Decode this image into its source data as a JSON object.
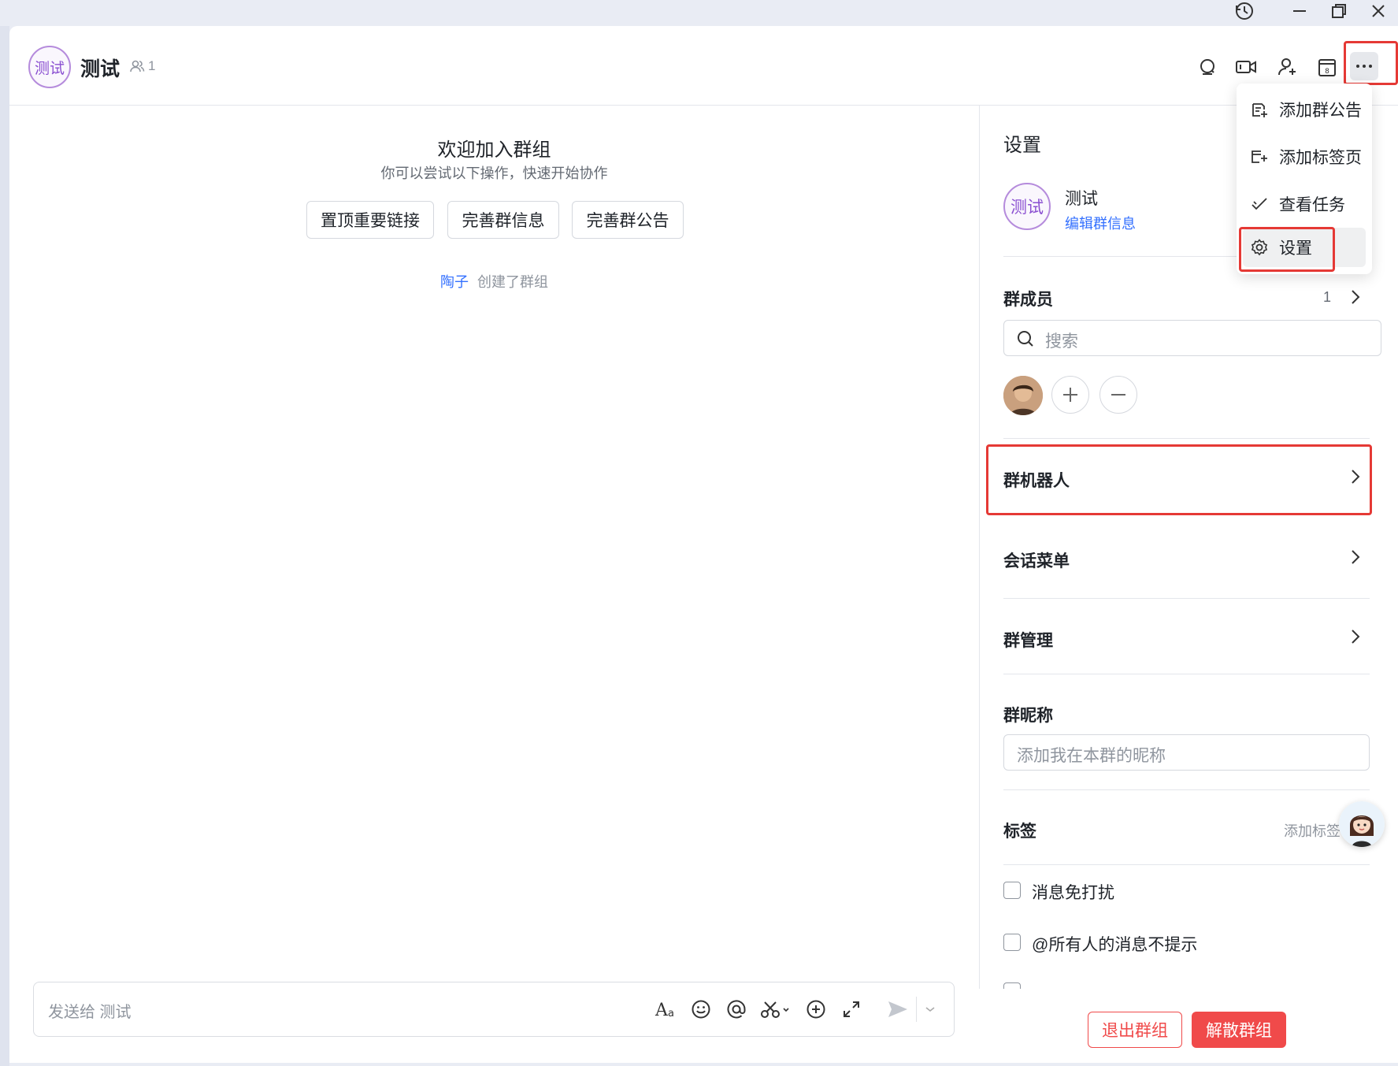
{
  "header": {
    "group_avatar_text": "测试",
    "group_name": "测试",
    "member_count": "1"
  },
  "chat": {
    "welcome_title": "欢迎加入群组",
    "welcome_subtitle": "你可以尝试以下操作，快速开始协作",
    "quick_actions": [
      "置顶重要链接",
      "完善群信息",
      "完善群公告"
    ],
    "creator_name": "陶子",
    "creator_action": "创建了群组"
  },
  "composer": {
    "placeholder": "发送给 测试"
  },
  "menu": {
    "items": [
      {
        "label": "添加群公告",
        "icon": "announcement-add-icon"
      },
      {
        "label": "添加标签页",
        "icon": "tab-add-icon"
      },
      {
        "label": "查看任务",
        "icon": "task-check-icon"
      },
      {
        "label": "设置",
        "icon": "gear-icon"
      }
    ]
  },
  "settings": {
    "title": "设置",
    "group_avatar_text": "测试",
    "group_name": "测试",
    "edit_info_link": "编辑群信息",
    "members_title": "群成员",
    "members_count": "1",
    "search_placeholder": "搜索",
    "bots_title": "群机器人",
    "session_menu_title": "会话菜单",
    "group_manage_title": "群管理",
    "nickname_title": "群昵称",
    "nickname_placeholder": "添加我在本群的昵称",
    "tags_title": "标签",
    "add_tag_label": "添加标签",
    "mute_label": "消息免打扰",
    "at_all_label": "@所有人的消息不提示",
    "leave_button": "退出群组",
    "dissolve_button": "解散群组"
  },
  "colors": {
    "accent_red": "#e53935",
    "danger_button": "#f04a4a",
    "link_blue": "#3370ff",
    "avatar_purple": "#8a4fd1"
  }
}
